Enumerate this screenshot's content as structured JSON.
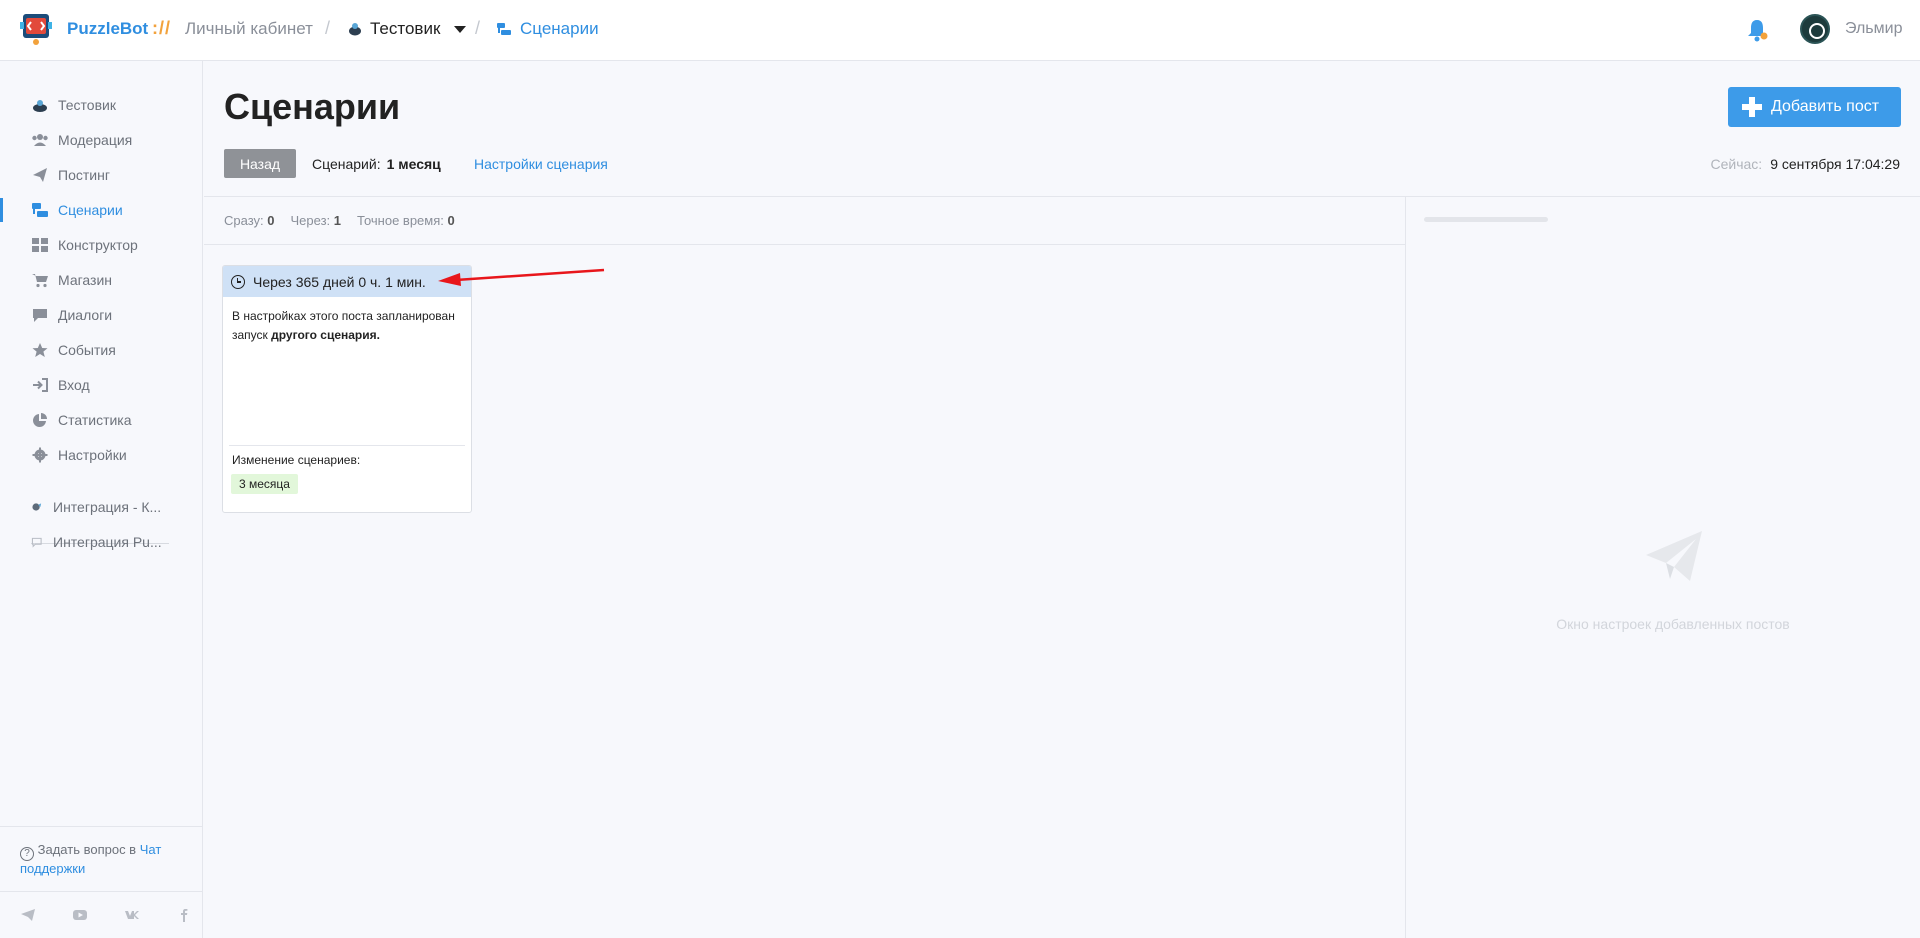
{
  "header": {
    "brand": "PuzzleBot",
    "brand_sep": "://",
    "cabinet": "Личный кабинет",
    "bot_name": "Тестовик",
    "current_section": "Сценарии",
    "username": "Эльмир"
  },
  "sidebar": {
    "items": [
      {
        "label": "Тестовик",
        "icon": "bot-icon"
      },
      {
        "label": "Модерация",
        "icon": "users-icon"
      },
      {
        "label": "Постинг",
        "icon": "paper-plane-icon"
      },
      {
        "label": "Сценарии",
        "icon": "scenarios-icon"
      },
      {
        "label": "Конструктор",
        "icon": "grid-icon"
      },
      {
        "label": "Магазин",
        "icon": "cart-icon"
      },
      {
        "label": "Диалоги",
        "icon": "chat-icon"
      },
      {
        "label": "События",
        "icon": "star-icon"
      },
      {
        "label": "Вход",
        "icon": "sign-in-icon"
      },
      {
        "label": "Статистика",
        "icon": "pie-chart-icon"
      },
      {
        "label": "Настройки",
        "icon": "gear-icon"
      }
    ],
    "integrations": [
      {
        "label": "Интеграция - К..."
      },
      {
        "label": "Интеграция Pu..."
      }
    ],
    "help_prefix": "Задать вопрос в",
    "help_link": "Чат поддержки"
  },
  "page": {
    "title": "Сценарии",
    "add_post_label": "Добавить пост",
    "back_label": "Назад",
    "scenario_label": "Сценарий:",
    "scenario_name": "1 месяц",
    "scenario_settings": "Настройки сценария",
    "now_label": "Сейчас:",
    "now_value": "9 сентября 17:04:29"
  },
  "counts": {
    "immediate_label": "Сразу:",
    "immediate_value": "0",
    "delay_label": "Через:",
    "delay_value": "1",
    "exact_label": "Точное время:",
    "exact_value": "0"
  },
  "post_card": {
    "header": "Через 365 дней 0 ч. 1 мин.",
    "body_text": "В настройках этого поста запланирован запуск",
    "body_bold": "другого сценария.",
    "footer_label": "Изменение сценариев:",
    "tag": "3 месяца"
  },
  "right_panel": {
    "placeholder": "Окно настроек добавленных постов"
  },
  "colors": {
    "accent": "#2f8ee0",
    "button": "#3d9be9",
    "card_header": "#cfe1f6",
    "tag_bg": "#e2f7da",
    "annotation_arrow": "#e8161b"
  }
}
